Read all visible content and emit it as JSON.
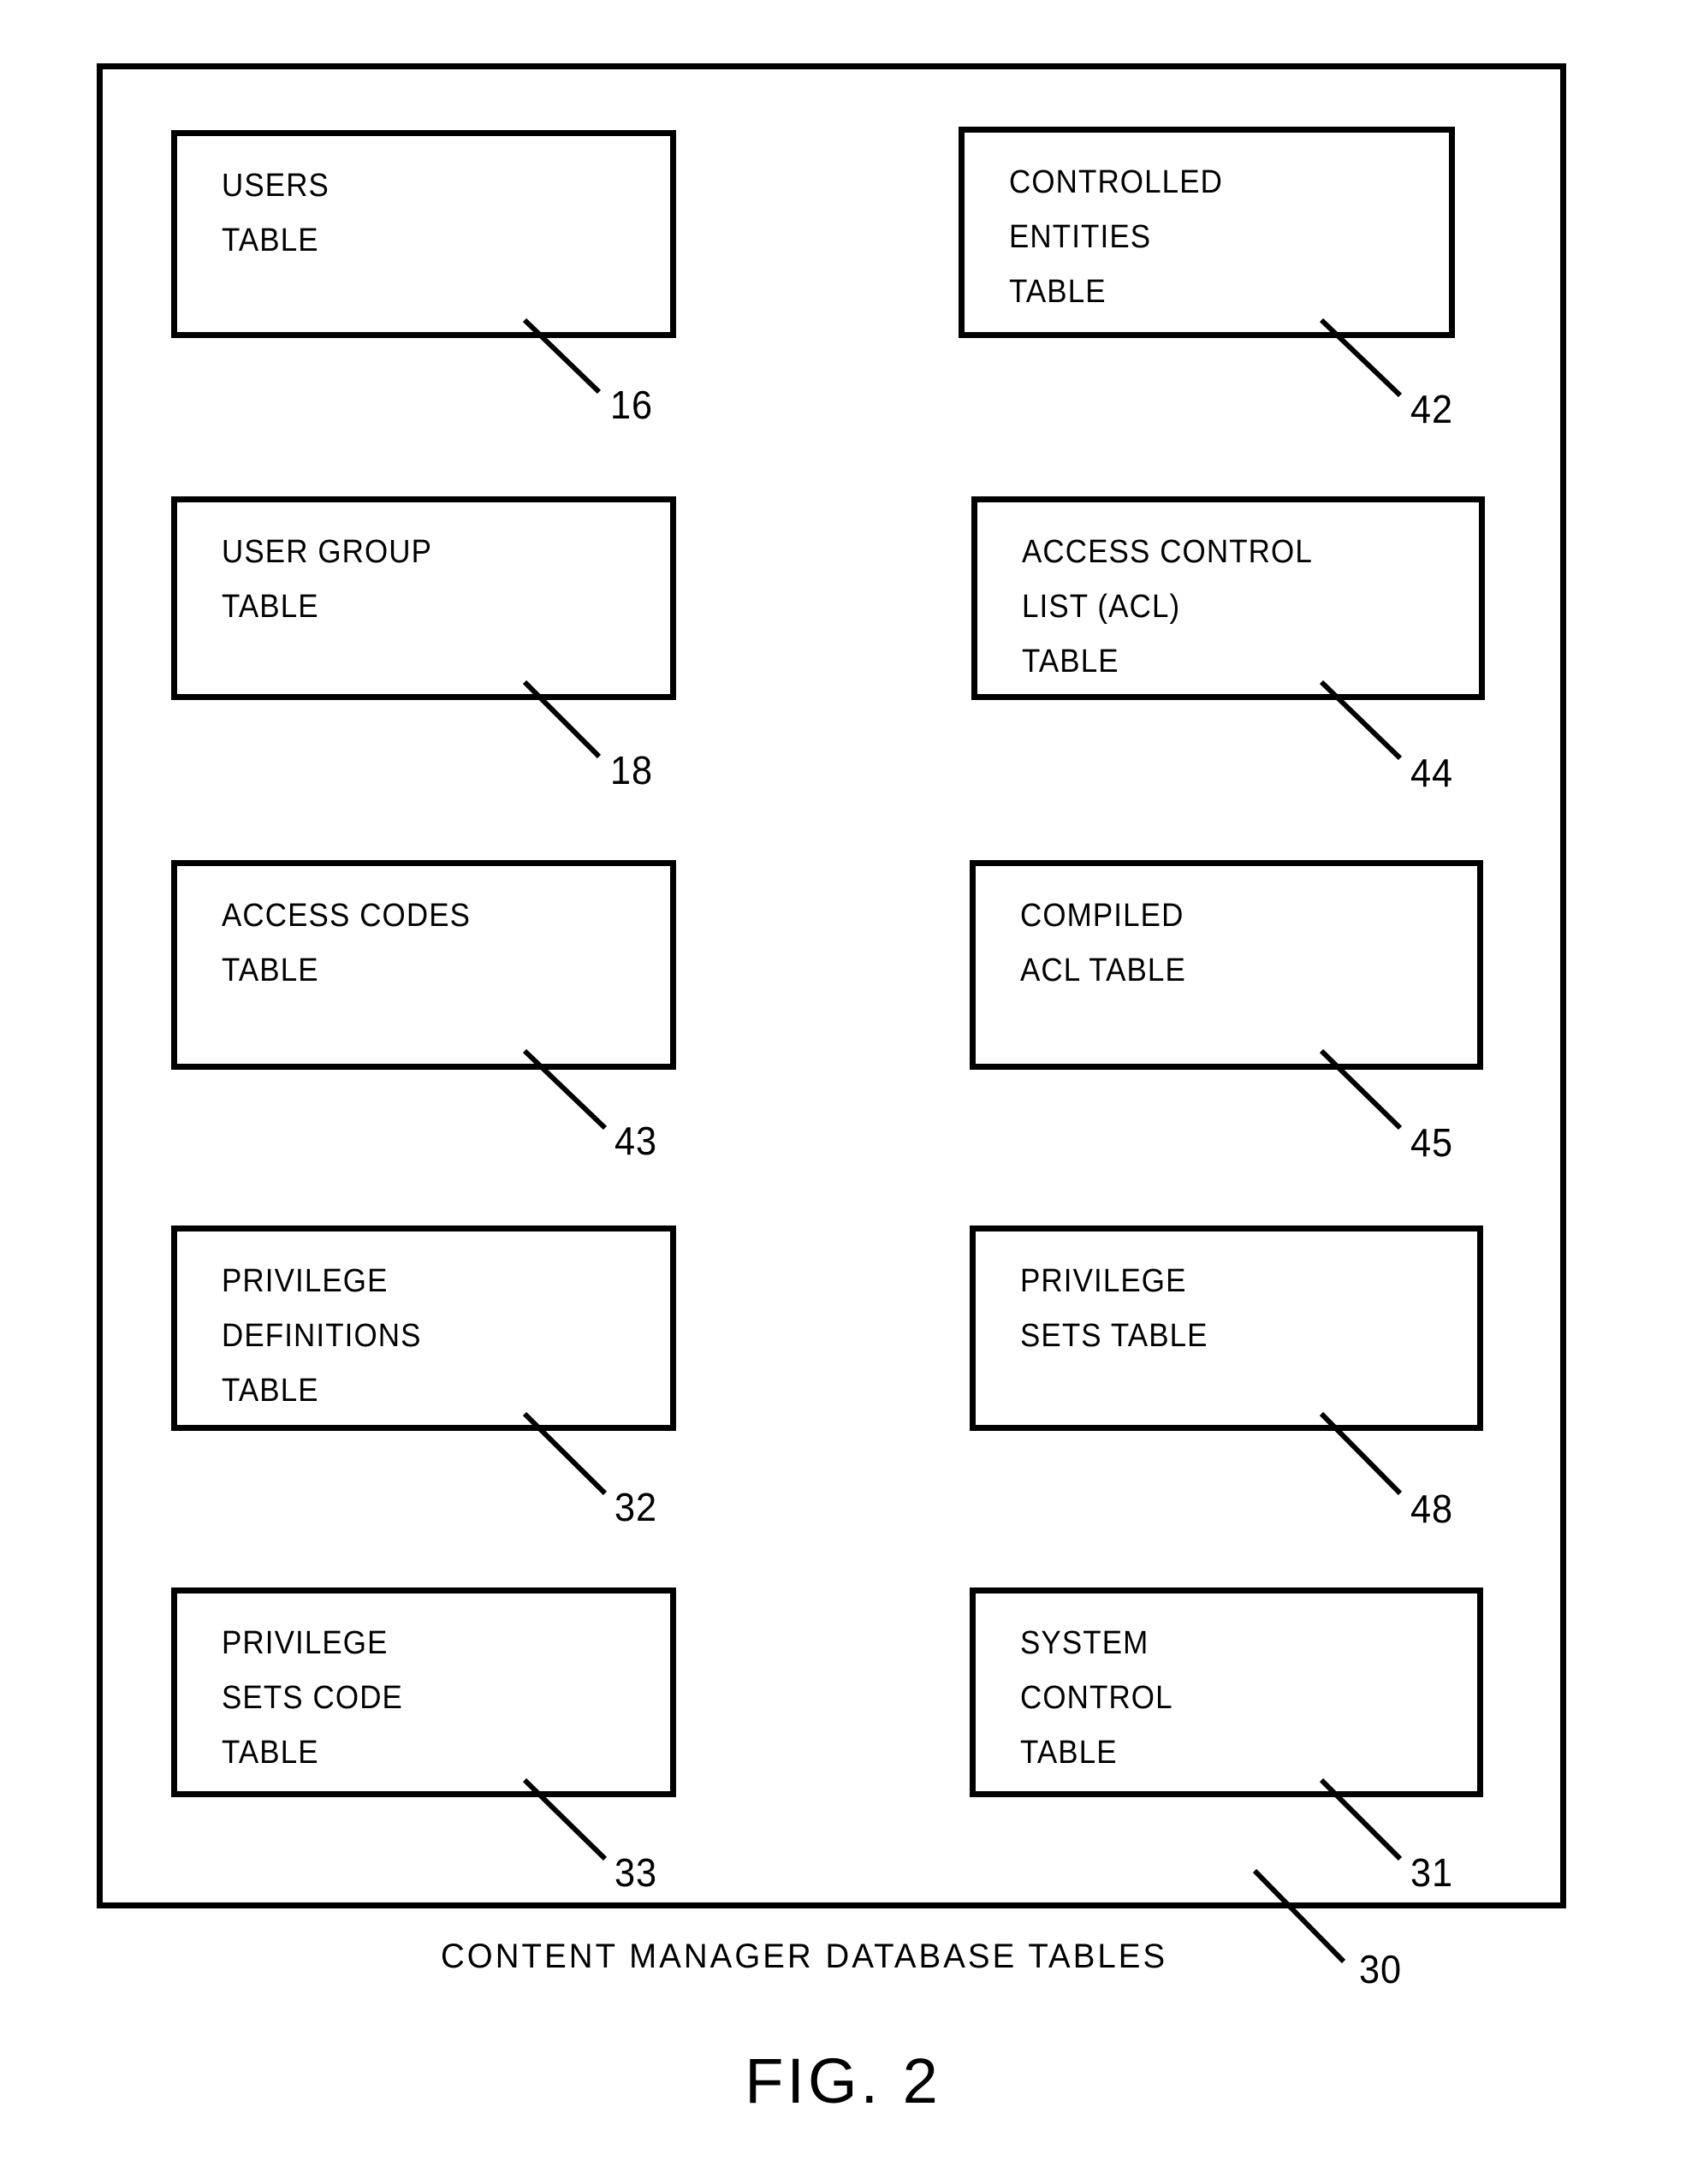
{
  "figure": {
    "title": "FIG. 2",
    "caption": "CONTENT MANAGER DATABASE TABLES",
    "frame_ref": "30"
  },
  "boxes": [
    {
      "id": "users-table",
      "lines": [
        "USERS",
        "TABLE"
      ],
      "ref": "16",
      "column": "left",
      "row": 1
    },
    {
      "id": "controlled-entities-table",
      "lines": [
        "CONTROLLED",
        "ENTITIES",
        "TABLE"
      ],
      "ref": "42",
      "column": "right",
      "row": 1
    },
    {
      "id": "user-group-table",
      "lines": [
        "USER GROUP",
        "TABLE"
      ],
      "ref": "18",
      "column": "left",
      "row": 2
    },
    {
      "id": "access-control-list-acl-table",
      "lines": [
        "ACCESS CONTROL",
        "LIST (ACL)",
        "TABLE"
      ],
      "ref": "44",
      "column": "right",
      "row": 2
    },
    {
      "id": "access-codes-table",
      "lines": [
        "ACCESS CODES",
        "TABLE"
      ],
      "ref": "43",
      "column": "left",
      "row": 3
    },
    {
      "id": "compiled-acl-table",
      "lines": [
        "COMPILED",
        "ACL TABLE"
      ],
      "ref": "45",
      "column": "right",
      "row": 3
    },
    {
      "id": "privilege-definitions-table",
      "lines": [
        "PRIVILEGE",
        "DEFINITIONS",
        "TABLE"
      ],
      "ref": "32",
      "column": "left",
      "row": 4
    },
    {
      "id": "privilege-sets-table",
      "lines": [
        "PRIVILEGE",
        "SETS TABLE"
      ],
      "ref": "48",
      "column": "right",
      "row": 4
    },
    {
      "id": "privilege-sets-code-table",
      "lines": [
        "PRIVILEGE",
        "SETS CODE",
        "TABLE"
      ],
      "ref": "33",
      "column": "left",
      "row": 5
    },
    {
      "id": "system-control-table",
      "lines": [
        "SYSTEM",
        "CONTROL",
        "TABLE"
      ],
      "ref": "31",
      "column": "right",
      "row": 5
    }
  ],
  "box_text": {
    "b1_l1": "USERS",
    "b1_l2": "TABLE",
    "b2_l1": "CONTROLLED",
    "b2_l2": "ENTITIES",
    "b2_l3": "TABLE",
    "b3_l1": "USER GROUP",
    "b3_l2": "TABLE",
    "b4_l1": "ACCESS CONTROL",
    "b4_l2": "LIST (ACL)",
    "b4_l3": "TABLE",
    "b5_l1": "ACCESS CODES",
    "b5_l2": "TABLE",
    "b6_l1": "COMPILED",
    "b6_l2": "ACL TABLE",
    "b7_l1": "PRIVILEGE",
    "b7_l2": "DEFINITIONS",
    "b7_l3": "TABLE",
    "b8_l1": "PRIVILEGE",
    "b8_l2": "SETS TABLE",
    "b9_l1": "PRIVILEGE",
    "b9_l2": "SETS CODE",
    "b9_l3": "TABLE",
    "b10_l1": "SYSTEM",
    "b10_l2": "CONTROL",
    "b10_l3": "TABLE"
  },
  "refs": {
    "r16": "16",
    "r42": "42",
    "r18": "18",
    "r44": "44",
    "r43": "43",
    "r45": "45",
    "r32": "32",
    "r48": "48",
    "r33": "33",
    "r31": "31",
    "r30": "30"
  },
  "colors": {
    "ink": "#000000",
    "paper": "#ffffff"
  }
}
